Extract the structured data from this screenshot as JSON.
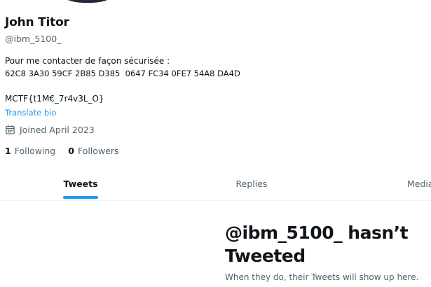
{
  "profile": {
    "display_name": "John Titor",
    "handle": "@ibm_5100_",
    "bio": {
      "line1": "Pour me contacter de façon sécurisée :",
      "line2": "62C8 3A30 59CF 2B85 D385  0647 FC34 0FE7 54A8 DA4D",
      "line3": "MCTF{t1M€_7r4v3L_O}"
    },
    "translate_label": "Translate bio",
    "joined": {
      "icon": "calendar-icon",
      "text": "Joined April 2023"
    },
    "following": {
      "count": "1",
      "label": "Following"
    },
    "followers": {
      "count": "0",
      "label": "Followers"
    }
  },
  "tabs": [
    {
      "label": "Tweets",
      "active": true
    },
    {
      "label": "Replies",
      "active": false
    },
    {
      "label": "Media",
      "active": false
    }
  ],
  "empty_state": {
    "title": "@ibm_5100_ hasn’t Tweeted",
    "subtitle": "When they do, their Tweets will show up here."
  },
  "colors": {
    "accent": "#1d9bf0",
    "text_primary": "#0f1419",
    "text_secondary": "#536471"
  }
}
